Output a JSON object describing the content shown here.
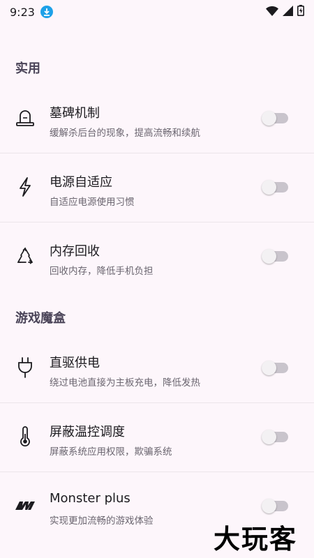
{
  "status": {
    "time": "9:23"
  },
  "sections": [
    {
      "title": "实用"
    },
    {
      "title": "游戏魔盒"
    }
  ],
  "rows": [
    {
      "title": "墓碑机制",
      "subtitle": "缓解杀后台的现象，提高流畅和续航",
      "icon": "tombstone-icon",
      "enabled": false
    },
    {
      "title": "电源自适应",
      "subtitle": "自适应电源使用习惯",
      "icon": "lightning-icon",
      "enabled": false
    },
    {
      "title": "内存回收",
      "subtitle": "回收内存，降低手机负担",
      "icon": "recycle-icon",
      "enabled": false
    },
    {
      "title": "直驱供电",
      "subtitle": "绕过电池直接为主板充电，降低发热",
      "icon": "plug-icon",
      "enabled": false
    },
    {
      "title": "屏蔽温控调度",
      "subtitle": "屏蔽系统应用权限，欺骗系统",
      "icon": "thermometer-icon",
      "enabled": false
    },
    {
      "title": "Monster plus",
      "subtitle": "实现更加流畅的游戏体验",
      "icon": "monster-logo-icon",
      "enabled": false
    }
  ],
  "watermark": "大玩客"
}
